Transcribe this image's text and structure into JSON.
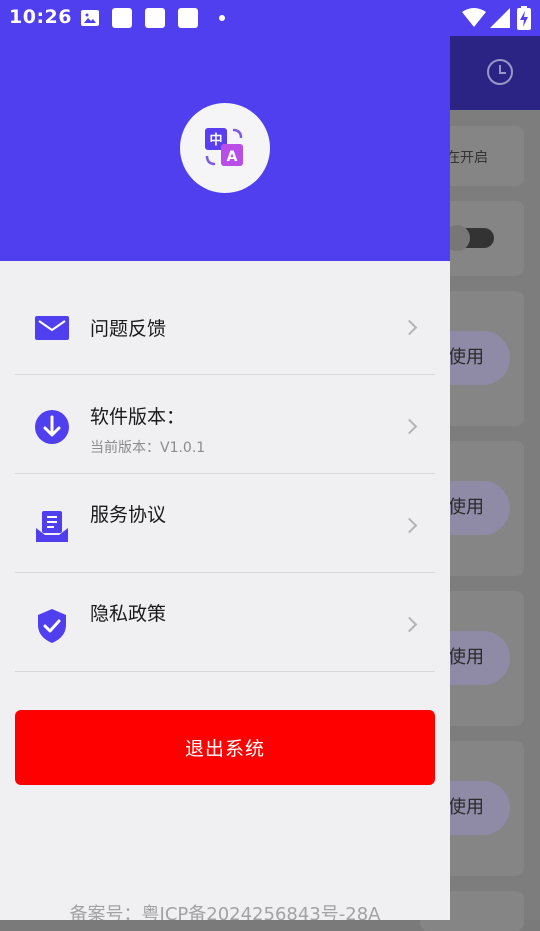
{
  "status_bar": {
    "time": "10:26"
  },
  "drawer": {
    "menu": [
      {
        "title": "问题反馈",
        "subtitle": "",
        "icon": "mail-icon"
      },
      {
        "title": "软件版本：",
        "subtitle": "当前版本：V1.0.1",
        "icon": "download-icon"
      },
      {
        "title": "服务协议",
        "subtitle": "",
        "icon": "document-tray-icon"
      },
      {
        "title": "隐私政策",
        "subtitle": "",
        "icon": "shield-check-icon"
      }
    ],
    "logout_label": "退出系统",
    "icp": "备案号：粤ICP备2024256843号-28A"
  },
  "background_app": {
    "card_text": "在开启",
    "use_label": "使用"
  },
  "colors": {
    "accent": "#4f3fef",
    "logout": "#ff0000"
  }
}
